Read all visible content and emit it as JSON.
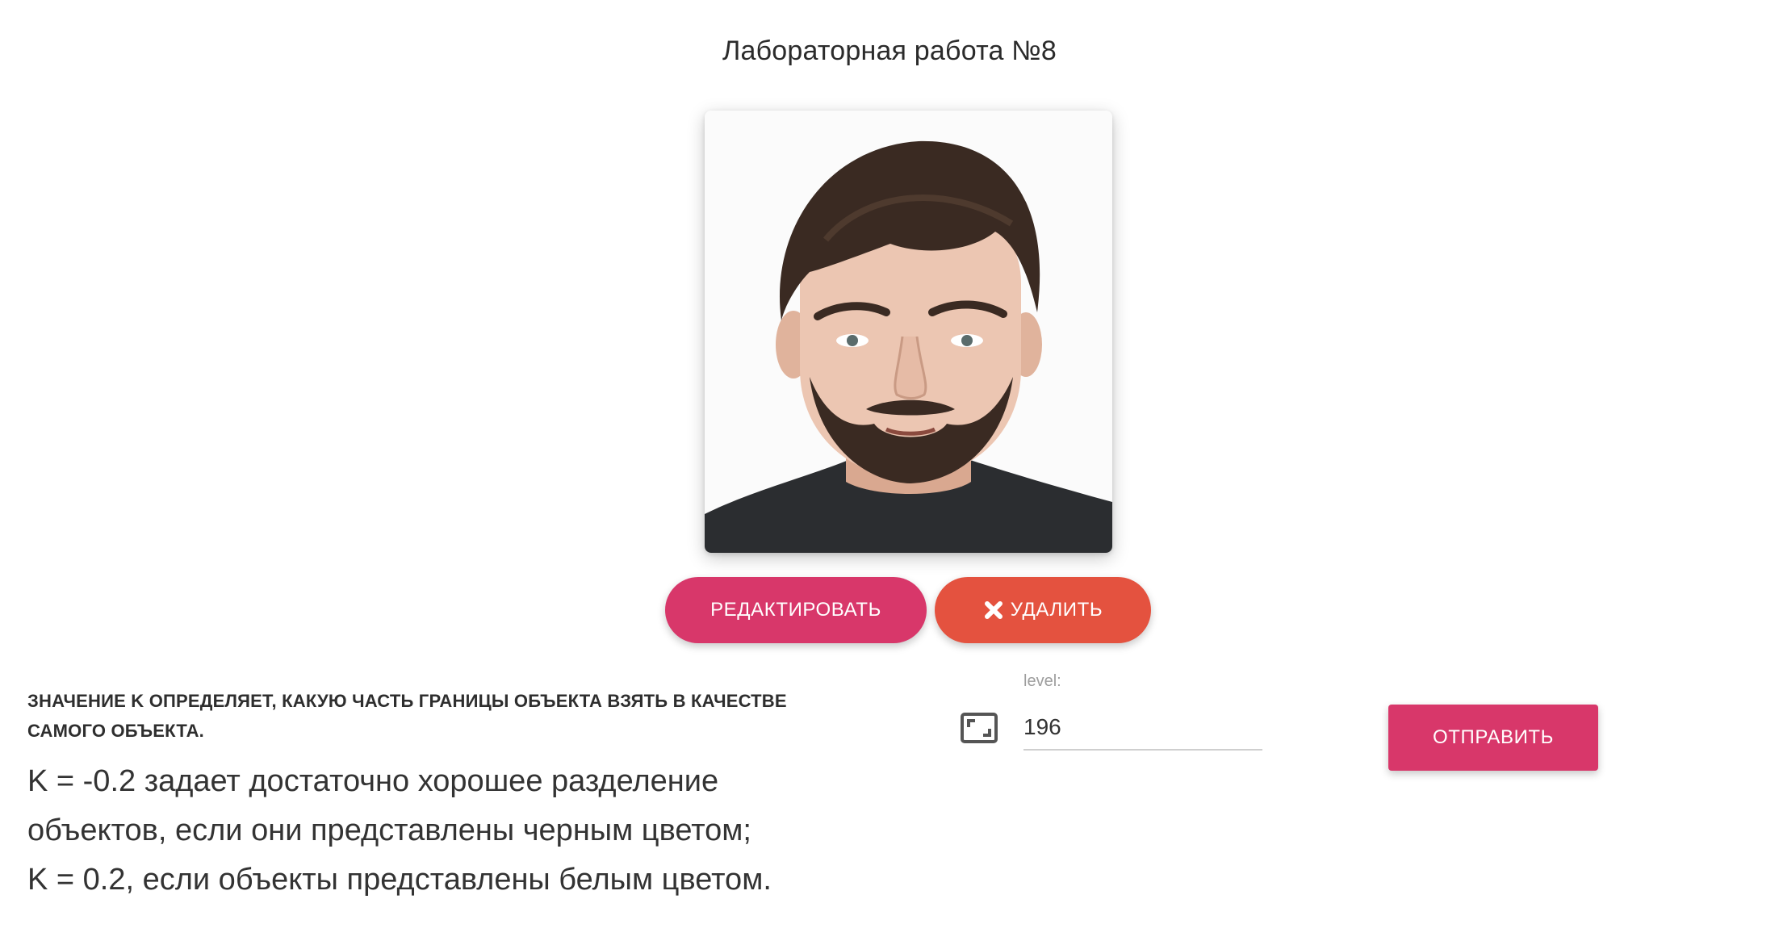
{
  "header": {
    "title": "Лабораторная работа №8"
  },
  "photo": {
    "description_icon": "portrait-photo"
  },
  "actions": {
    "edit_label": "РЕДАКТИРОВАТЬ",
    "delete_label": "УДАЛИТЬ",
    "delete_icon": "close-icon",
    "edit_color": "#d8376a",
    "delete_color": "#e4523f"
  },
  "description": {
    "caps": "Значение K определяет, какую часть границы объекта взять в качестве самого объекта.",
    "lines": [
      "K = -0.2 задает достаточно хорошее разделение",
      "объектов, если они представлены черным цветом;",
      "K = 0.2, если объекты представлены белым цветом."
    ]
  },
  "level_field": {
    "label": "level:",
    "value": "196",
    "icon": "aspect-ratio-icon"
  },
  "submit": {
    "label": "ОТПРАВИТЬ",
    "color": "#d8376a"
  }
}
